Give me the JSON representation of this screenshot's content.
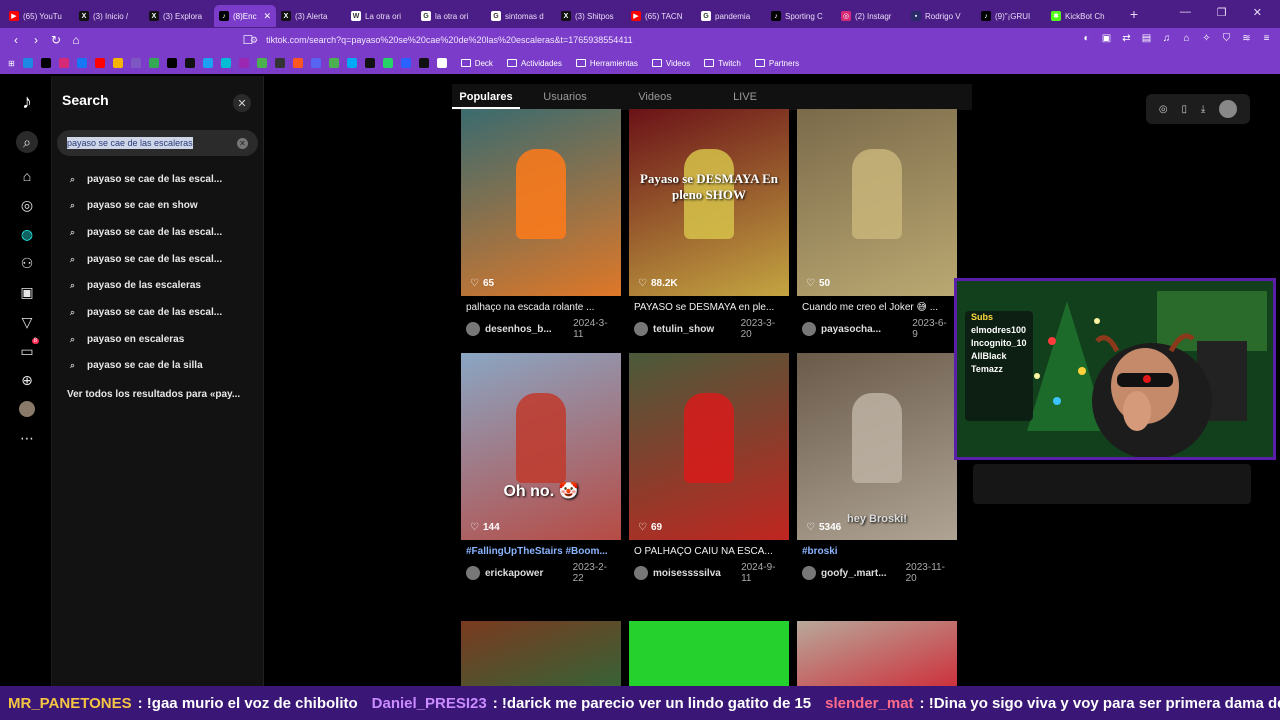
{
  "browser": {
    "tabs": [
      {
        "label": "(65) YouTu",
        "color": "#ff0000",
        "glyph": "▶"
      },
      {
        "label": "(3) Inicio /",
        "color": "#111111",
        "glyph": "X"
      },
      {
        "label": "(3) Explora",
        "color": "#111111",
        "glyph": "X"
      },
      {
        "label": "(8)Enc",
        "color": "#000000",
        "glyph": "♪",
        "active": true
      },
      {
        "label": "(3) Alerta",
        "color": "#111111",
        "glyph": "X"
      },
      {
        "label": "La otra ori",
        "color": "#ffffff",
        "glyph": "W"
      },
      {
        "label": "la otra ori",
        "color": "#ffffff",
        "glyph": "G"
      },
      {
        "label": "sintomas d",
        "color": "#ffffff",
        "glyph": "G"
      },
      {
        "label": "(3) Shitpos",
        "color": "#111111",
        "glyph": "X"
      },
      {
        "label": "(65) TACN",
        "color": "#ff0000",
        "glyph": "▶"
      },
      {
        "label": "pandemia",
        "color": "#ffffff",
        "glyph": "G"
      },
      {
        "label": "Sporting C",
        "color": "#000000",
        "glyph": "♪"
      },
      {
        "label": "(2) Instagr",
        "color": "#d62976",
        "glyph": "◎"
      },
      {
        "label": "Rodrigo V",
        "color": "#2b2b6b",
        "glyph": "▪"
      },
      {
        "label": "(9)\"¡GRUI",
        "color": "#000000",
        "glyph": "♪"
      },
      {
        "label": "KickBot Ch",
        "color": "#53fc18",
        "glyph": "✱"
      }
    ],
    "close_tab": "✕",
    "new_tab": "+",
    "url": "tiktok.com/search?q=payaso%20se%20cae%20de%20las%20escaleras&t=1765938554411",
    "bookmarks_folders": [
      "Deck",
      "Actividades",
      "Herramientas",
      "Videos",
      "Twitch",
      "Partners"
    ]
  },
  "sidebar": {
    "title": "Search",
    "query": "payaso se cae de las escaleras",
    "suggestions": [
      "payaso se cae de las escal...",
      "payaso se cae en show",
      "payaso se cae de las escal...",
      "payaso se cae de las escal...",
      "payaso de las escaleras",
      "payaso se cae de las escal...",
      "payaso en escaleras",
      "payaso se cae de la silla"
    ],
    "see_all": "Ver todos los resultados para «pay...",
    "notification_count": "8"
  },
  "results": {
    "tabs": [
      "Populares",
      "Usuarios",
      "Videos",
      "LIVE"
    ],
    "videos": [
      {
        "likes": "65",
        "caption": "palhaço na escada rolante ...",
        "user": "desenhos_b...",
        "date": "2024-3-11",
        "bg": "#3a6b6f",
        "accent": "#ff7a1a"
      },
      {
        "likes": "88.2K",
        "caption": "PAYASO se DESMAYA en ple...",
        "user": "tetulin_show",
        "date": "2023-3-20",
        "bg": "#6b1218",
        "accent": "#d6c24a",
        "overlay": "Payaso se DESMAYA En pleno SHOW"
      },
      {
        "likes": "50",
        "caption": "Cuando me creo el Joker 😅 ...",
        "user": "payasocha...",
        "date": "2023-6-9",
        "bg": "#7a6a4a",
        "accent": "#c8b57a"
      },
      {
        "likes": "144",
        "caption": "#FallingUpTheStairs #Boom...",
        "user": "erickapower",
        "date": "2023-2-22",
        "bg": "#8aa6c4",
        "accent": "#c0392b",
        "overlay": "Oh no. 🤡",
        "tag": true
      },
      {
        "likes": "69",
        "caption": "O PALHAÇO CAIU NA ESCA...",
        "user": "moisessssilva",
        "date": "2024-9-11",
        "bg": "#4a5a3a",
        "accent": "#d81b1b"
      },
      {
        "likes": "5346",
        "caption": "#broski",
        "user": "goofy_.mart...",
        "date": "2023-11-20",
        "bg": "#6a5a4a",
        "accent": "#bdb3a3",
        "overlay": "hey Broski!",
        "tag": true
      },
      {
        "likes": "",
        "caption": "",
        "user": "",
        "date": "",
        "bg": "#7a3a20",
        "accent": "#2a6a3a"
      },
      {
        "likes": "",
        "caption": "",
        "user": "",
        "date": "",
        "bg": "#25d12c",
        "accent": "#25d12c"
      },
      {
        "likes": "",
        "caption": "",
        "user": "",
        "date": "",
        "bg": "#b8a89a",
        "accent": "#d11a2a"
      }
    ]
  },
  "webcam": {
    "sign_lines": [
      "Subs",
      "elmodres100",
      "Incognito_10",
      "AllBlack",
      "Temazz"
    ]
  },
  "chat": [
    {
      "user": "MR_PANETONES",
      "color": "#f4c542",
      "msg": ": !gaa murio el voz de chibolito"
    },
    {
      "user": "Daniel_PRESI23",
      "color": "#c98bff",
      "msg": ": !darick me parecio ver un lindo gatito de 15"
    },
    {
      "user": "slender_mat",
      "color": "#ff6b8a",
      "msg": ": !Dina yo sigo viva y voy para ser primera dama de jeri"
    }
  ]
}
